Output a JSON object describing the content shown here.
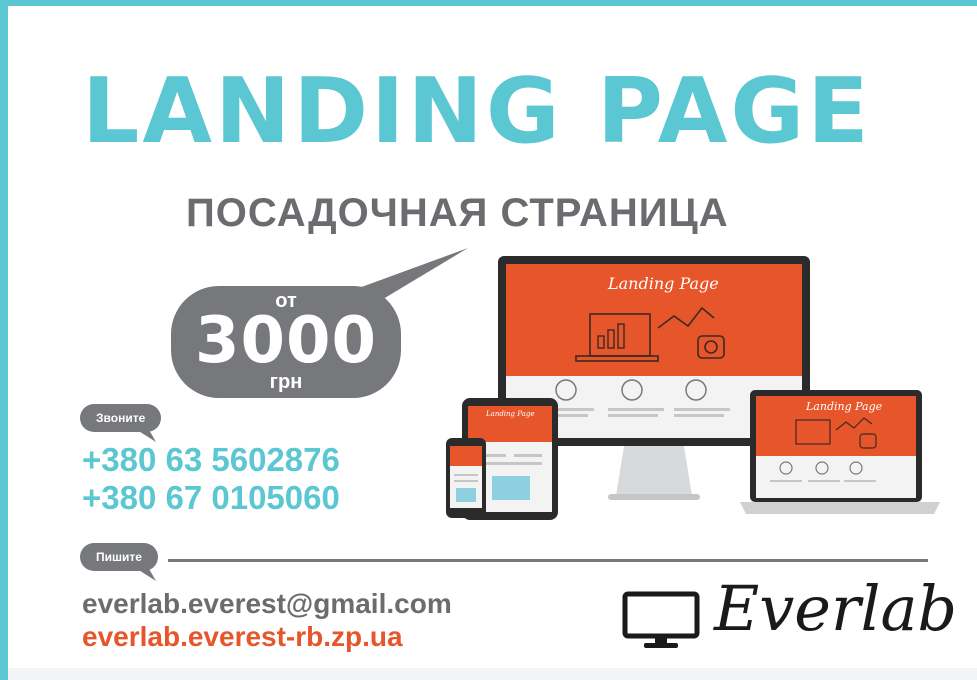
{
  "header": {
    "title": "LANDING PAGE",
    "subtitle": "ПОСАДОЧНАЯ СТРАНИЦА"
  },
  "price": {
    "prefix": "от",
    "amount": "3000",
    "currency": "грн"
  },
  "contacts": {
    "call_label": "Звоните",
    "phones": [
      "+380 63 5602876",
      "+380 67 0105060"
    ],
    "write_label": "Пишите",
    "email": "everlab.everest@gmail.com",
    "website": "everlab.everest-rb.zp.ua"
  },
  "brand": {
    "name": "Everlab",
    "icon": "monitor-icon"
  },
  "devices": {
    "screen_title": "Landing Page"
  },
  "colors": {
    "accent": "#5bc7d2",
    "gray": "#77787b",
    "orange": "#e7562b"
  }
}
